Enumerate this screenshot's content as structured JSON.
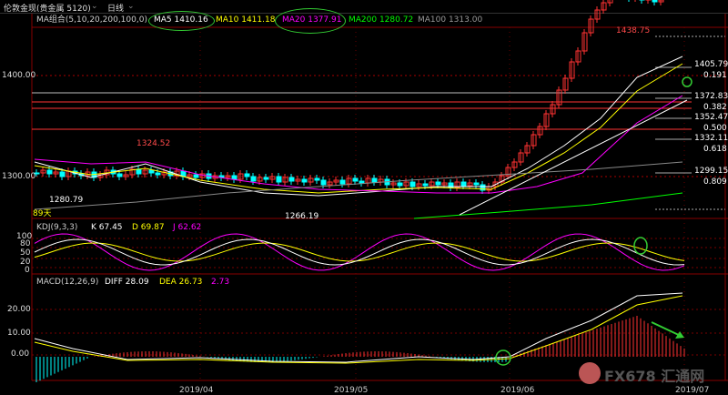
{
  "toolbar": {
    "instrument": "伦敦金现(贵金属 5120)",
    "period": "日线"
  },
  "main_legend": {
    "ma_group": "MA组合(5,10,20,200,100,0)",
    "ma5": "MA5 1410.16",
    "ma10": "MA10 1411.18",
    "ma20": "MA20 1377.91",
    "ma200": "MA200 1280.72",
    "ma100": "MA100 1313.00"
  },
  "price_axis": [
    "1400.00",
    "1300.00"
  ],
  "annotations": {
    "high": "1438.75",
    "p1324": "1324.52",
    "p1280": "1280.79",
    "p1266": "1266.19",
    "days": "89天"
  },
  "fib_levels": [
    {
      "price": "1405.79",
      "ratio": "0.191"
    },
    {
      "price": "1372.83",
      "ratio": "0.382"
    },
    {
      "price": "1352.47",
      "ratio": "0.500"
    },
    {
      "price": "1332.11",
      "ratio": "0.618"
    },
    {
      "price": "1299.15",
      "ratio": "0.809"
    }
  ],
  "kdj_legend": {
    "name": "KDJ(9,3,3)",
    "k": "K 67.45",
    "d": "D 69.87",
    "j": "J 62.62"
  },
  "kdj_axis": [
    "100",
    "80",
    "50",
    "20",
    "0"
  ],
  "macd_legend": {
    "name": "MACD(12,26,9)",
    "diff": "DIFF 28.09",
    "dea": "DEA 26.73",
    "macd": "2.73"
  },
  "macd_axis": [
    "20.00",
    "10.00",
    "0.00"
  ],
  "time_axis": [
    "2019/04",
    "2019/05",
    "2019/06",
    "2019/07"
  ],
  "watermark": "FX678 汇通网",
  "colors": {
    "up": "#ff3232",
    "down": "#00ffff",
    "ma5": "#ffffff",
    "ma10": "#ffff00",
    "ma20": "#ff00ff",
    "ma200": "#00ff00",
    "ma100": "#888888",
    "highlight": "#33cc33"
  }
}
